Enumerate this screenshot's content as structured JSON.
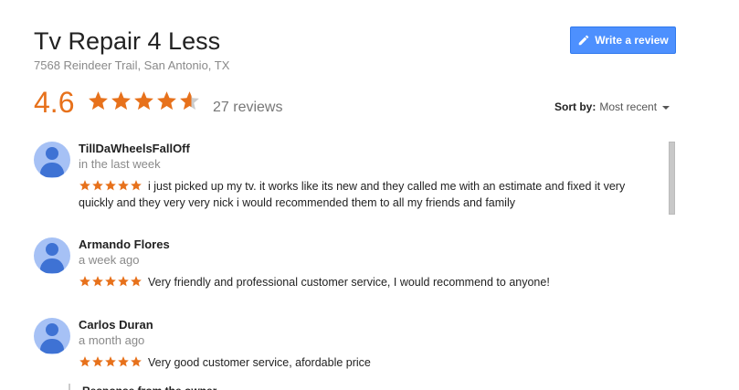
{
  "business": {
    "name": "Tv Repair 4 Less",
    "address": "7568 Reindeer Trail, San Antonio, TX",
    "rating": "4.6",
    "rating_value": 4.6,
    "review_count": "27 reviews"
  },
  "actions": {
    "write_review_label": "Write a review"
  },
  "sort": {
    "label": "Sort by:",
    "value": "Most recent"
  },
  "colors": {
    "accent": "#e7711b",
    "button": "#4d90fe",
    "avatar": "#a6c1f5"
  },
  "reviews": [
    {
      "author": "TillDaWheelsFallOff",
      "time": "in the last week",
      "stars": 5,
      "text": "i just picked up my tv. it works like its new and they called me with an estimate and fixed it very quickly and they very very nick i would recommended them to all my friends and family"
    },
    {
      "author": "Armando Flores",
      "time": "a week ago",
      "stars": 5,
      "text": "Very friendly and professional customer service, I would recommend to anyone!"
    },
    {
      "author": "Carlos Duran",
      "time": "a month ago",
      "stars": 5,
      "text": "Very good customer service, afordable price"
    }
  ],
  "partial_response": "Response from the owner"
}
